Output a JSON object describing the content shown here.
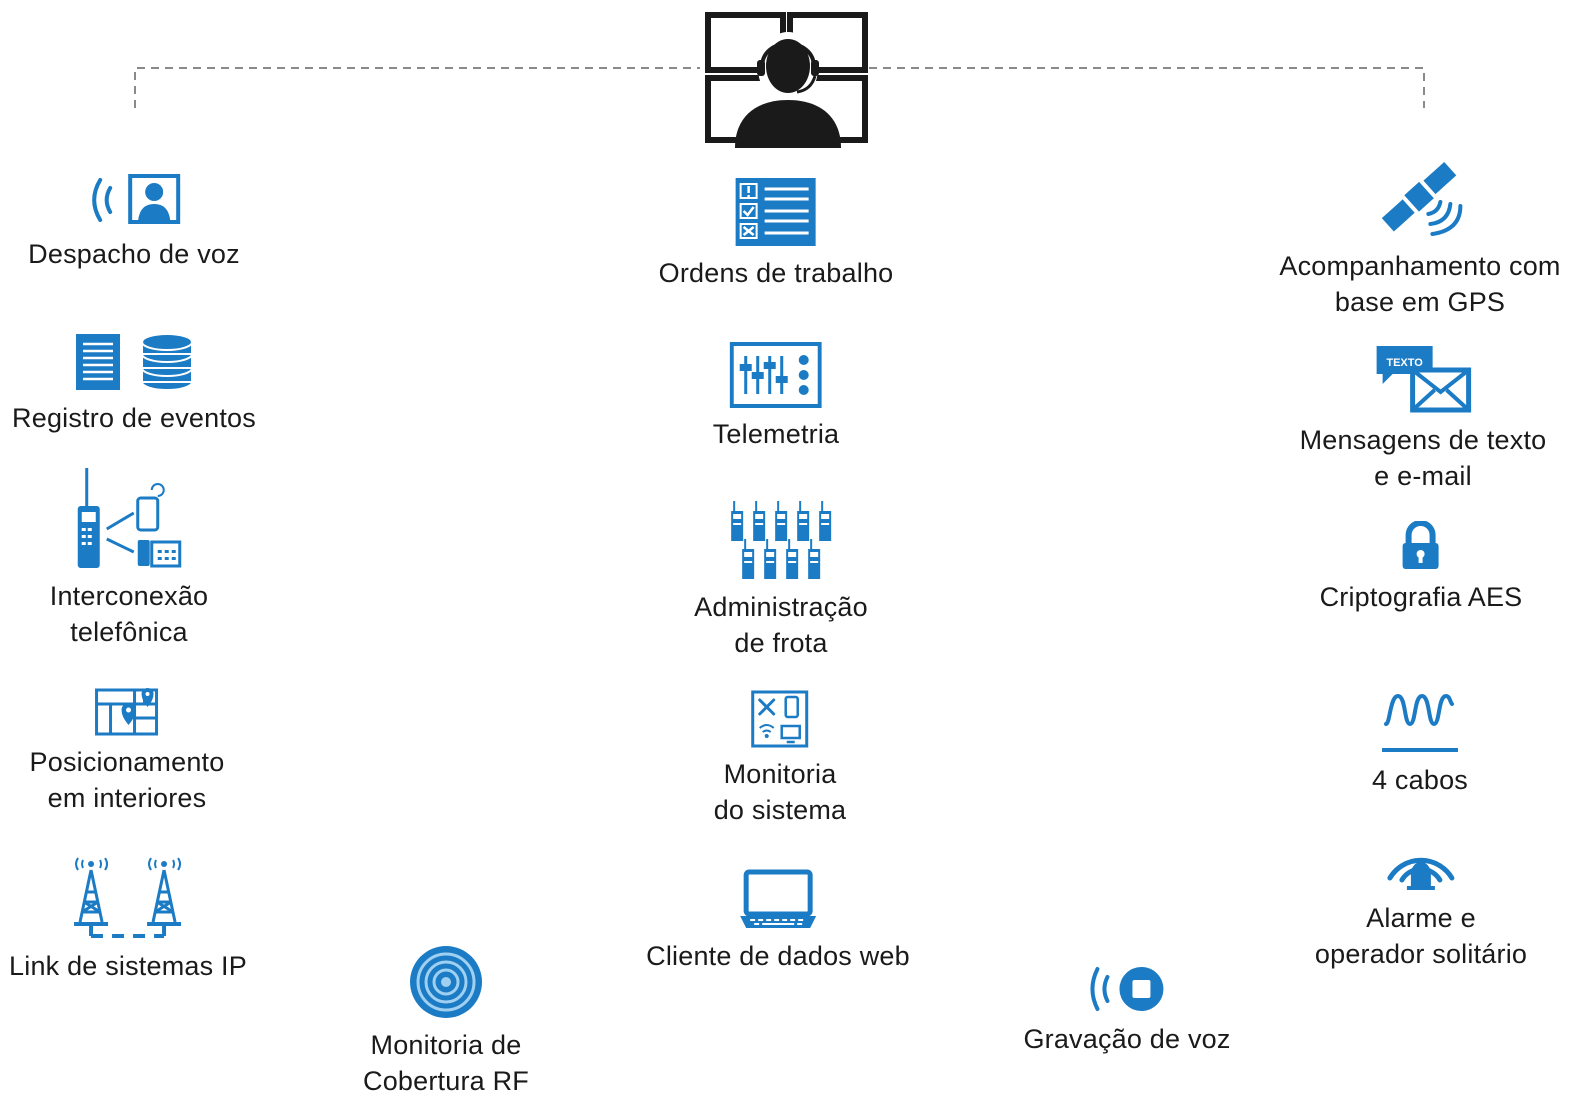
{
  "colors": {
    "accent": "#1b7bc4",
    "operator": "#1a1a1a",
    "connector": "#8a8a8a"
  },
  "operator": {
    "icon": "dispatcher-console-icon"
  },
  "left_column": [
    {
      "icon": "voice-dispatch-icon",
      "lines": [
        "Despacho de voz"
      ]
    },
    {
      "icon": "event-log-icon",
      "lines": [
        "Registro de eventos"
      ]
    },
    {
      "icon": "telephone-interconnect-icon",
      "lines": [
        "Interconexão",
        "telefônica"
      ]
    },
    {
      "icon": "indoor-location-icon",
      "lines": [
        "Posicionamento",
        "em interiores"
      ]
    },
    {
      "icon": "ip-site-link-icon",
      "lines": [
        "Link de sistemas IP"
      ]
    }
  ],
  "center_column": [
    {
      "icon": "work-order-icon",
      "lines": [
        "Ordens de trabalho"
      ]
    },
    {
      "icon": "telemetry-icon",
      "lines": [
        "Telemetria"
      ]
    },
    {
      "icon": "fleet-radios-icon",
      "lines": [
        "Administração",
        "de frota"
      ]
    },
    {
      "icon": "system-monitoring-icon",
      "lines": [
        "Monitoria",
        "do sistema"
      ]
    },
    {
      "icon": "laptop-icon",
      "lines": [
        "Cliente de dados web"
      ]
    }
  ],
  "right_column": [
    {
      "icon": "gps-satellite-icon",
      "lines": [
        "Acompanhamento com",
        "base em GPS"
      ]
    },
    {
      "icon": "text-email-icon",
      "badge": "TEXTO",
      "lines": [
        "Mensagens de texto",
        "e e-mail"
      ]
    },
    {
      "icon": "lock-icon",
      "lines": [
        "Criptografia AES"
      ]
    },
    {
      "icon": "waveform-icon",
      "lines": [
        "4 cabos"
      ]
    },
    {
      "icon": "alarm-bell-icon",
      "lines": [
        "Alarme e",
        "operador solitário"
      ]
    }
  ],
  "bottom_row": [
    {
      "icon": "rf-coverage-target-icon",
      "lines": [
        "Monitoria de",
        "Cobertura RF"
      ]
    },
    {
      "icon": "voice-recording-icon",
      "lines": [
        "Gravação de voz"
      ]
    }
  ]
}
